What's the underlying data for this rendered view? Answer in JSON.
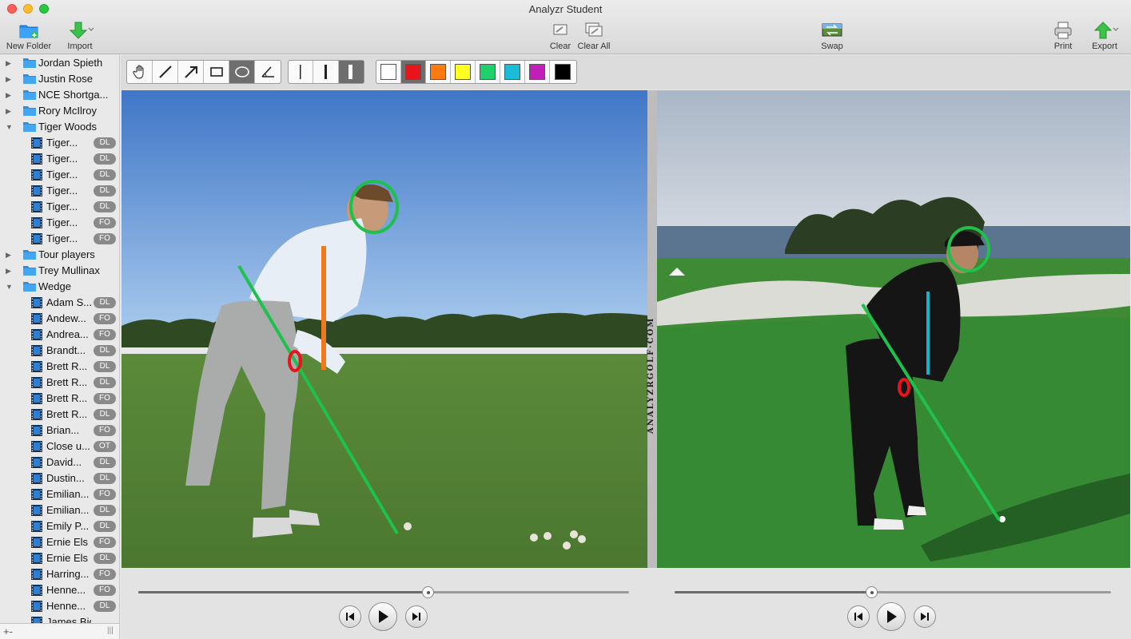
{
  "window": {
    "title": "Analyzr Student"
  },
  "toolbar": {
    "new_folder": "New Folder",
    "import": "Import",
    "clear": "Clear",
    "clear_all": "Clear All",
    "swap": "Swap",
    "print": "Print",
    "export": "Export"
  },
  "sidebar": {
    "folders": [
      "Jordan Spieth",
      "Justin Rose",
      "NCE Shortga...",
      "Rory McIlroy",
      "Tiger Woods",
      "Tour players",
      "Trey Mullinax",
      "Wedge"
    ],
    "tiger_files": [
      {
        "name": "Tiger...",
        "badge": "DL"
      },
      {
        "name": "Tiger...",
        "badge": "DL"
      },
      {
        "name": "Tiger...",
        "badge": "DL"
      },
      {
        "name": "Tiger...",
        "badge": "DL"
      },
      {
        "name": "Tiger...",
        "badge": "DL"
      },
      {
        "name": "Tiger...",
        "badge": "FO"
      },
      {
        "name": "Tiger...",
        "badge": "FO"
      }
    ],
    "wedge_files": [
      {
        "name": "Adam S...",
        "badge": "DL"
      },
      {
        "name": "Andew...",
        "badge": "FO"
      },
      {
        "name": "Andrea...",
        "badge": "FO"
      },
      {
        "name": "Brandt...",
        "badge": "DL"
      },
      {
        "name": "Brett R...",
        "badge": "DL"
      },
      {
        "name": "Brett R...",
        "badge": "DL"
      },
      {
        "name": "Brett R...",
        "badge": "FO"
      },
      {
        "name": "Brett R...",
        "badge": "DL"
      },
      {
        "name": "Brian...",
        "badge": "FO"
      },
      {
        "name": "Close u...",
        "badge": "OT"
      },
      {
        "name": "David...",
        "badge": "DL"
      },
      {
        "name": "Dustin...",
        "badge": "DL"
      },
      {
        "name": "Emilian...",
        "badge": "FO"
      },
      {
        "name": "Emilian...",
        "badge": "DL"
      },
      {
        "name": "Emily P...",
        "badge": "DL"
      },
      {
        "name": "Ernie Els",
        "badge": "FO"
      },
      {
        "name": "Ernie Els",
        "badge": "DL"
      },
      {
        "name": "Harring...",
        "badge": "FO"
      },
      {
        "name": "Henne...",
        "badge": "FO"
      },
      {
        "name": "Henne...",
        "badge": "DL"
      },
      {
        "name": "James Bidy",
        "badge": ""
      }
    ],
    "add_label": "+-"
  },
  "drawing": {
    "tools": [
      "hand-icon",
      "line-icon",
      "arrow-icon",
      "rectangle-icon",
      "ellipse-icon",
      "angle-icon"
    ],
    "selected_tool": 4,
    "widths": [
      "thin",
      "medium",
      "thick"
    ],
    "selected_width": 2,
    "colors": [
      "#ffffff",
      "#e8141b",
      "#ff7b0f",
      "#ffff22",
      "#1fd16a",
      "#1bbcd8",
      "#c020b8",
      "#000000"
    ],
    "selected_color": 1
  },
  "viewer": {
    "watermark": "ANALYZRGOLF·COM",
    "left_progress": 0.59,
    "right_progress": 0.45
  }
}
